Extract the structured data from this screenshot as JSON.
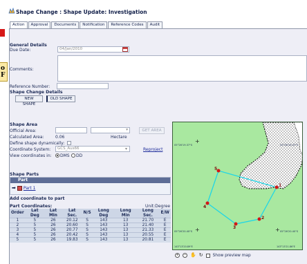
{
  "window": {
    "title": "Shape Change : Shape Update: Investigation"
  },
  "tabs": [
    "Action",
    "Approval",
    "Documents",
    "Notification",
    "Reference Codes",
    "Audit"
  ],
  "general": {
    "heading": "General Details",
    "due_date_label": "Due Date:",
    "due_date_value": "04/Jan/2010",
    "comments_label": "Comments:",
    "reference_label": "Reference Number:"
  },
  "shape_change": {
    "heading": "Shape Change Details",
    "new_shape_label": "NEW SHAPE",
    "old_shape_label": "OLD SHAPE"
  },
  "shape_area": {
    "heading": "Shape Area",
    "official_area_label": "Official Area:",
    "get_area_label": "GET AREA",
    "calculated_area_label": "Calculated Area:",
    "calculated_area_value": "0.06",
    "calculated_area_unit": "Hectare",
    "define_dynamic_label": "Define shape dynamically:",
    "coord_system_label": "Coordinate System:",
    "coord_system_value": "GCS_Aus66",
    "reproject_label": "Reproject",
    "view_coords_label": "View coordinates in:",
    "dms_label": "DMS",
    "dd_label": "DD"
  },
  "shape_parts": {
    "heading": "Shape Parts",
    "column": "Part",
    "items": [
      "Part 1"
    ]
  },
  "add_coordinate": {
    "label": "Add coordinate to part"
  },
  "part_coordinates": {
    "heading": "Part Coordinates:",
    "unit_label": "Unit:Degree",
    "columns": [
      "Order",
      "Lat Deg",
      "Lat Min",
      "Lat Sec.",
      "N/S",
      "Long Deg",
      "Long Min",
      "Long Sec.",
      "E/W"
    ],
    "rows": [
      [
        "1",
        "5",
        "26",
        "20.12",
        "S",
        "143",
        "13",
        "21.70",
        "E"
      ],
      [
        "2",
        "5",
        "26",
        "20.60",
        "S",
        "143",
        "13",
        "21.40",
        "E"
      ],
      [
        "3",
        "5",
        "26",
        "20.77",
        "S",
        "143",
        "13",
        "21.33",
        "E"
      ],
      [
        "4",
        "5",
        "26",
        "20.42",
        "S",
        "143",
        "13",
        "20.55",
        "E"
      ],
      [
        "5",
        "5",
        "26",
        "19.83",
        "S",
        "143",
        "13",
        "20.81",
        "E"
      ]
    ]
  },
  "map": {
    "lon_left_label": "143°13'20.89\"E",
    "lon_right_label": "143°13'21.86\"E",
    "lat_top_left": "05°26'19.37\"S",
    "lat_top_right": "05°26'19.37\"S",
    "lat_bottom_left": "05°26'20.40\"S",
    "lat_bottom_right": "05°26'20.40\"S",
    "vertex_labels": [
      "1",
      "2",
      "3",
      "4",
      "5"
    ],
    "preview_label": "Show preview map"
  }
}
